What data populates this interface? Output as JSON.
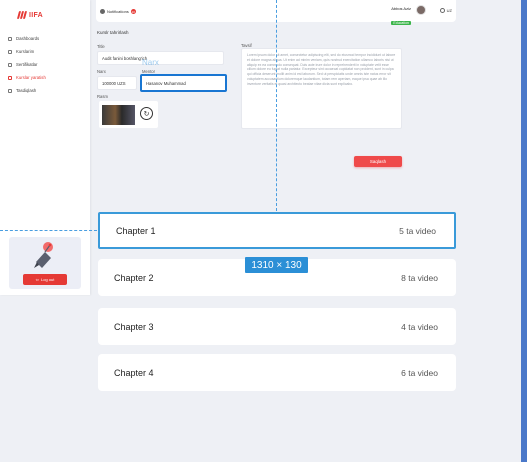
{
  "sidebar": {
    "logo_text": "IIFA",
    "nav": [
      {
        "label": "Dashboards",
        "icon": "grid-icon"
      },
      {
        "label": "Kurslarim",
        "icon": "book-icon"
      },
      {
        "label": "Sertifikatlar",
        "icon": "certificate-icon"
      },
      {
        "label": "Kurslar yaratish",
        "icon": "plus-icon"
      },
      {
        "label": "Tasdiqlash",
        "icon": "check-icon"
      }
    ],
    "active_index": 3,
    "logout_label": "Log out"
  },
  "topbar": {
    "notifications_label": "Notifications",
    "notifications_count": "10",
    "user_name": "Abbos Aziz",
    "user_role": "Education",
    "language": "UZ"
  },
  "form": {
    "title": "Kurslr tahrirlash",
    "title_label": "Title",
    "title_value": "Audit fanini boshlang'ich",
    "price_label": "Narx",
    "price_value": "100000 UZS",
    "teacher_label": "Mentor",
    "teacher_value": "Hasanov Muhammad",
    "image_label": "Rasm",
    "description_label": "Tavsif",
    "description_text": "Lorem ipsum dolor sit amet, consectetur adipiscing elit, sed do eiusmod tempor incididunt ut labore et dolore magna aliqua. Ut enim ad minim veniam, quis nostrud exercitation ullamco laboris nisi ut aliquip ex ea commodo consequat. Duis aute irure dolor in reprehenderit in voluptate velit esse cillum dolore eu fugiat nulla pariatur. Excepteur sint occaecat cupidatat non proident, sunt in culpa qui officia deserunt mollit anim id est laborum. Sed ut perspiciatis unde omnis iste natus error sit voluptatem accusantium doloremque laudantium, totam rem aperiam, eaque ipsa quae ab illo inventore veritatis et quasi architecto beatae vitae dicta sunt explicabo.",
    "save_label": "Saqlash",
    "ghost_label": "Narx"
  },
  "chapters": [
    {
      "title": "Chapter 1",
      "count": "5 ta video"
    },
    {
      "title": "Chapter 2",
      "count": "8 ta video"
    },
    {
      "title": "Chapter 3",
      "count": "4 ta video"
    },
    {
      "title": "Chapter 4",
      "count": "6 ta video"
    }
  ],
  "size_tag": "1310 × 130",
  "colors": {
    "brand_red": "#e53935",
    "accent_blue": "#2b8fd6",
    "page_bg": "#eef0f5"
  }
}
